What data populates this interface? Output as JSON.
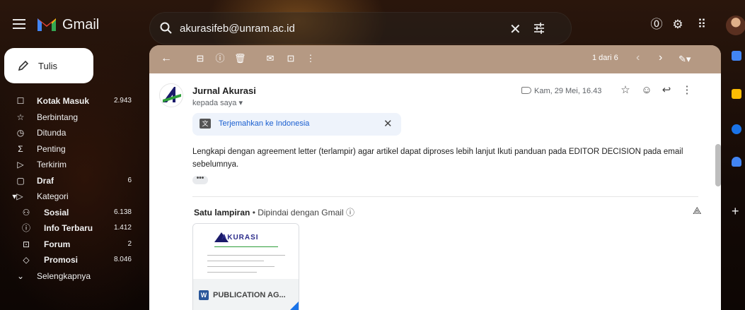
{
  "app": {
    "name": "Gmail"
  },
  "search": {
    "value": "akurasifeb@unram.ac.id"
  },
  "compose": {
    "label": "Tulis"
  },
  "sidebar": {
    "items": [
      {
        "label": "Kotak Masuk",
        "count": "2.943",
        "icon": "inbox-icon",
        "bold": true
      },
      {
        "label": "Berbintang",
        "count": "",
        "icon": "star-icon",
        "bold": false
      },
      {
        "label": "Ditunda",
        "count": "",
        "icon": "clock-icon",
        "bold": false
      },
      {
        "label": "Penting",
        "count": "",
        "icon": "important-icon",
        "bold": false
      },
      {
        "label": "Terkirim",
        "count": "",
        "icon": "send-icon",
        "bold": false
      },
      {
        "label": "Draf",
        "count": "6",
        "icon": "draft-icon",
        "bold": true
      },
      {
        "label": "Kategori",
        "count": "",
        "icon": "label-icon",
        "bold": false
      },
      {
        "label": "Sosial",
        "count": "6.138",
        "icon": "people-icon",
        "bold": true
      },
      {
        "label": "Info Terbaru",
        "count": "1.412",
        "icon": "info-icon",
        "bold": true
      },
      {
        "label": "Forum",
        "count": "2",
        "icon": "forum-icon",
        "bold": true
      },
      {
        "label": "Promosi",
        "count": "8.046",
        "icon": "tag-icon",
        "bold": true
      },
      {
        "label": "Selengkapnya",
        "count": "",
        "icon": "chevron-down-icon",
        "bold": false
      }
    ]
  },
  "toolbar": {
    "pagination": "1 dari 6"
  },
  "message": {
    "sender": "Jurnal Akurasi",
    "recipient": "kepada saya",
    "date": "Kam, 29 Mei, 16.43",
    "translate_label": "Terjemahkan ke Indonesia",
    "body": "Lengkapi dengan agreement letter (terlampir) agar artikel dapat diproses lebih lanjut  Ikuti panduan pada EDITOR DECISION pada email sebelumnya.",
    "ellipsis": "•••"
  },
  "attachments": {
    "title": "Satu lampiran",
    "meta": " • Dipindai dengan Gmail ⓘ",
    "file_name": "PUBLICATION AG...",
    "thumb_logo": "AKURASI",
    "file_type": "W"
  },
  "colors": {
    "accent": "#1a73e8",
    "word_blue": "#2b579a",
    "translate_bg": "#eef3fb"
  }
}
